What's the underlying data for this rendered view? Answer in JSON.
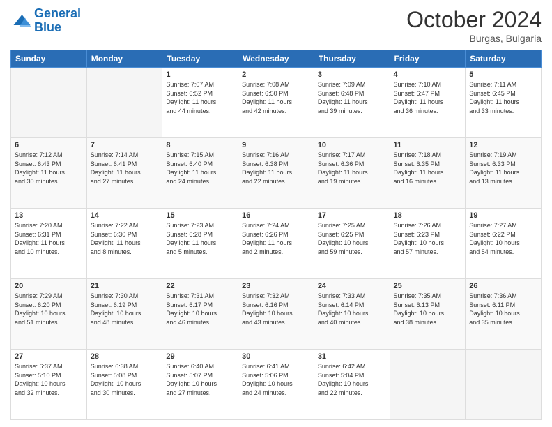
{
  "header": {
    "logo_line1": "General",
    "logo_line2": "Blue",
    "month": "October 2024",
    "location": "Burgas, Bulgaria"
  },
  "weekdays": [
    "Sunday",
    "Monday",
    "Tuesday",
    "Wednesday",
    "Thursday",
    "Friday",
    "Saturday"
  ],
  "weeks": [
    [
      {
        "day": "",
        "content": ""
      },
      {
        "day": "",
        "content": ""
      },
      {
        "day": "1",
        "content": "Sunrise: 7:07 AM\nSunset: 6:52 PM\nDaylight: 11 hours\nand 44 minutes."
      },
      {
        "day": "2",
        "content": "Sunrise: 7:08 AM\nSunset: 6:50 PM\nDaylight: 11 hours\nand 42 minutes."
      },
      {
        "day": "3",
        "content": "Sunrise: 7:09 AM\nSunset: 6:48 PM\nDaylight: 11 hours\nand 39 minutes."
      },
      {
        "day": "4",
        "content": "Sunrise: 7:10 AM\nSunset: 6:47 PM\nDaylight: 11 hours\nand 36 minutes."
      },
      {
        "day": "5",
        "content": "Sunrise: 7:11 AM\nSunset: 6:45 PM\nDaylight: 11 hours\nand 33 minutes."
      }
    ],
    [
      {
        "day": "6",
        "content": "Sunrise: 7:12 AM\nSunset: 6:43 PM\nDaylight: 11 hours\nand 30 minutes."
      },
      {
        "day": "7",
        "content": "Sunrise: 7:14 AM\nSunset: 6:41 PM\nDaylight: 11 hours\nand 27 minutes."
      },
      {
        "day": "8",
        "content": "Sunrise: 7:15 AM\nSunset: 6:40 PM\nDaylight: 11 hours\nand 24 minutes."
      },
      {
        "day": "9",
        "content": "Sunrise: 7:16 AM\nSunset: 6:38 PM\nDaylight: 11 hours\nand 22 minutes."
      },
      {
        "day": "10",
        "content": "Sunrise: 7:17 AM\nSunset: 6:36 PM\nDaylight: 11 hours\nand 19 minutes."
      },
      {
        "day": "11",
        "content": "Sunrise: 7:18 AM\nSunset: 6:35 PM\nDaylight: 11 hours\nand 16 minutes."
      },
      {
        "day": "12",
        "content": "Sunrise: 7:19 AM\nSunset: 6:33 PM\nDaylight: 11 hours\nand 13 minutes."
      }
    ],
    [
      {
        "day": "13",
        "content": "Sunrise: 7:20 AM\nSunset: 6:31 PM\nDaylight: 11 hours\nand 10 minutes."
      },
      {
        "day": "14",
        "content": "Sunrise: 7:22 AM\nSunset: 6:30 PM\nDaylight: 11 hours\nand 8 minutes."
      },
      {
        "day": "15",
        "content": "Sunrise: 7:23 AM\nSunset: 6:28 PM\nDaylight: 11 hours\nand 5 minutes."
      },
      {
        "day": "16",
        "content": "Sunrise: 7:24 AM\nSunset: 6:26 PM\nDaylight: 11 hours\nand 2 minutes."
      },
      {
        "day": "17",
        "content": "Sunrise: 7:25 AM\nSunset: 6:25 PM\nDaylight: 10 hours\nand 59 minutes."
      },
      {
        "day": "18",
        "content": "Sunrise: 7:26 AM\nSunset: 6:23 PM\nDaylight: 10 hours\nand 57 minutes."
      },
      {
        "day": "19",
        "content": "Sunrise: 7:27 AM\nSunset: 6:22 PM\nDaylight: 10 hours\nand 54 minutes."
      }
    ],
    [
      {
        "day": "20",
        "content": "Sunrise: 7:29 AM\nSunset: 6:20 PM\nDaylight: 10 hours\nand 51 minutes."
      },
      {
        "day": "21",
        "content": "Sunrise: 7:30 AM\nSunset: 6:19 PM\nDaylight: 10 hours\nand 48 minutes."
      },
      {
        "day": "22",
        "content": "Sunrise: 7:31 AM\nSunset: 6:17 PM\nDaylight: 10 hours\nand 46 minutes."
      },
      {
        "day": "23",
        "content": "Sunrise: 7:32 AM\nSunset: 6:16 PM\nDaylight: 10 hours\nand 43 minutes."
      },
      {
        "day": "24",
        "content": "Sunrise: 7:33 AM\nSunset: 6:14 PM\nDaylight: 10 hours\nand 40 minutes."
      },
      {
        "day": "25",
        "content": "Sunrise: 7:35 AM\nSunset: 6:13 PM\nDaylight: 10 hours\nand 38 minutes."
      },
      {
        "day": "26",
        "content": "Sunrise: 7:36 AM\nSunset: 6:11 PM\nDaylight: 10 hours\nand 35 minutes."
      }
    ],
    [
      {
        "day": "27",
        "content": "Sunrise: 6:37 AM\nSunset: 5:10 PM\nDaylight: 10 hours\nand 32 minutes."
      },
      {
        "day": "28",
        "content": "Sunrise: 6:38 AM\nSunset: 5:08 PM\nDaylight: 10 hours\nand 30 minutes."
      },
      {
        "day": "29",
        "content": "Sunrise: 6:40 AM\nSunset: 5:07 PM\nDaylight: 10 hours\nand 27 minutes."
      },
      {
        "day": "30",
        "content": "Sunrise: 6:41 AM\nSunset: 5:06 PM\nDaylight: 10 hours\nand 24 minutes."
      },
      {
        "day": "31",
        "content": "Sunrise: 6:42 AM\nSunset: 5:04 PM\nDaylight: 10 hours\nand 22 minutes."
      },
      {
        "day": "",
        "content": ""
      },
      {
        "day": "",
        "content": ""
      }
    ]
  ]
}
